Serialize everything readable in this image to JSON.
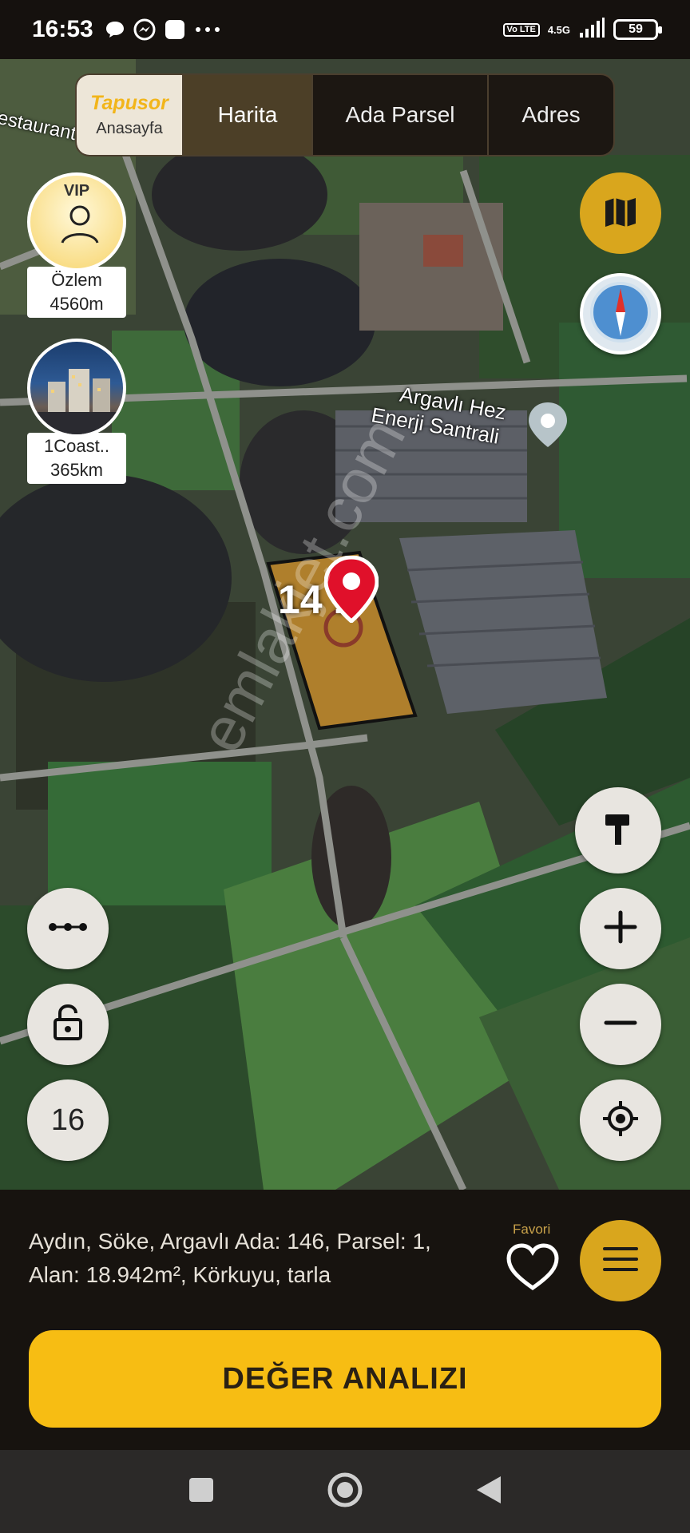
{
  "status": {
    "time": "16:53",
    "network": "4.5G",
    "volte": "Vo LTE",
    "battery": "59"
  },
  "header": {
    "brand": "Tapusor",
    "home": "Anasayfa",
    "tabs": [
      {
        "label": "Harita",
        "active": true
      },
      {
        "label": "Ada Parsel",
        "active": false
      },
      {
        "label": "Adres",
        "active": false
      }
    ]
  },
  "map": {
    "labels": {
      "restaurant": "estaurant",
      "plant_line1": "Argavlı Hez",
      "plant_line2": "Enerji Santrali"
    },
    "parcel_number": "14 1",
    "watermark": "emlakjet.com"
  },
  "pois": [
    {
      "badge": "VIP",
      "name": "Özlem",
      "distance": "4560m"
    },
    {
      "name": "1Coast..",
      "distance": "365km"
    }
  ],
  "controls": {
    "zoom_level": "16",
    "icons": [
      "map-icon",
      "compass-icon",
      "hammer-icon",
      "plus-icon",
      "minus-icon",
      "locate-icon",
      "measure-icon",
      "unlock-icon"
    ]
  },
  "info": {
    "line1": "Aydın, Söke, Argavlı Ada: 146, Parsel: 1,",
    "line2": "Alan: 18.942m², Körkuyu, tarla",
    "favorite_label": "Favori"
  },
  "cta": {
    "label": "DEĞER ANALIZI"
  },
  "colors": {
    "accent": "#f7bd13",
    "gold_button": "#d9a61d",
    "background": "#17130f"
  }
}
